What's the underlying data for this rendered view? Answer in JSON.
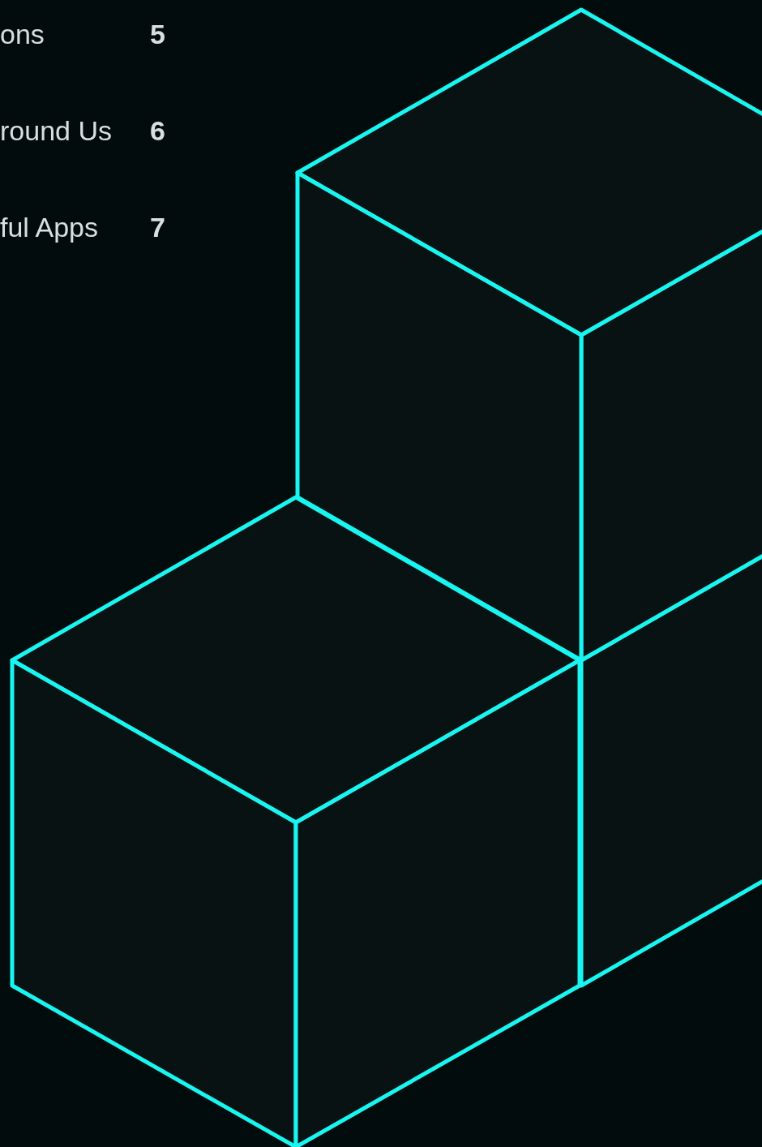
{
  "contents": [
    {
      "title": "ons",
      "page": "5"
    },
    {
      "title": "round Us",
      "page": "6"
    },
    {
      "title": "ful Apps",
      "page": "7"
    }
  ]
}
